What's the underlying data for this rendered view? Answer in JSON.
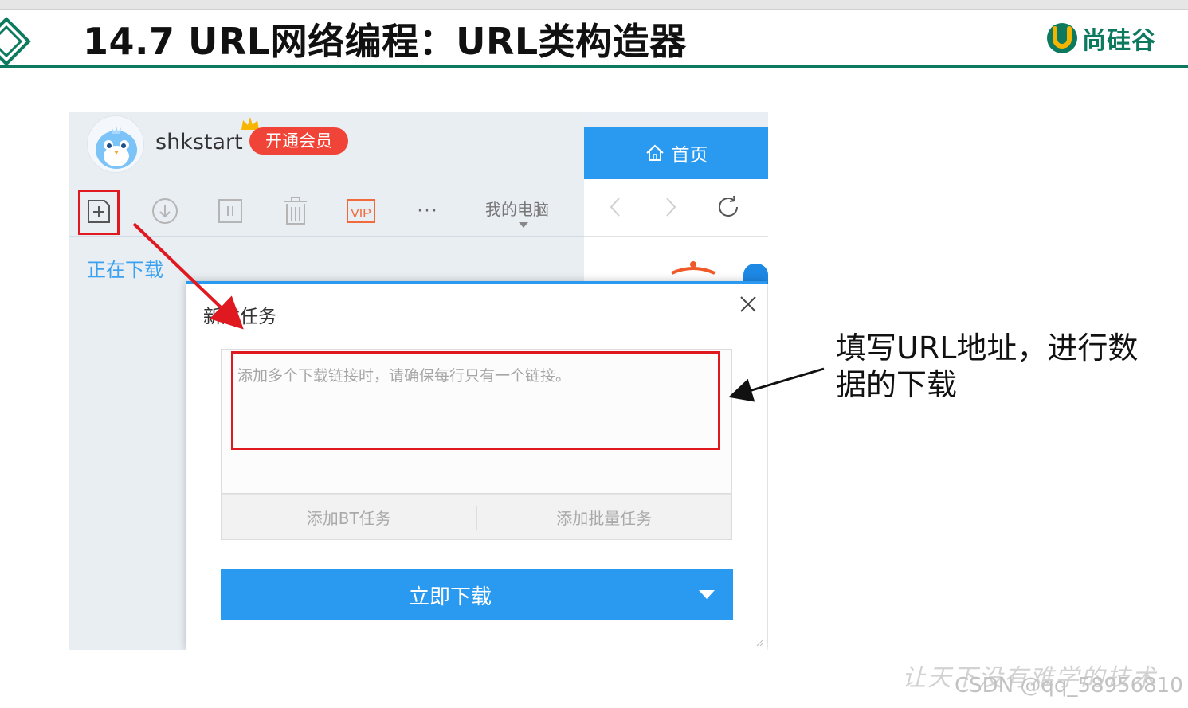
{
  "slide": {
    "title": "14.7 URL网络编程：URL类构造器",
    "brand": "尚硅谷",
    "annotation_line1": "填写URL地址，进行数",
    "annotation_line2": "据的下载",
    "watermark_script": "让天下没有难学的技术",
    "watermark": "CSDN @qq_58956810"
  },
  "colors": {
    "brand_green": "#0d7a5f",
    "accent_blue": "#2a9af0",
    "highlight_red": "#e0181f"
  },
  "app": {
    "username": "shkstart",
    "vip_label": "开通会员",
    "toolbar": {
      "icons": [
        "new-task-icon",
        "download-icon",
        "pause-icon",
        "trash-icon",
        "vip-icon",
        "more-icon"
      ],
      "vip_icon_text": "VIP",
      "more_text": "···",
      "computer_label": "我的电脑"
    },
    "downloading_label": "正在下载",
    "home_tab_label": "首页",
    "dialog": {
      "title": "新建任务",
      "url_placeholder": "添加多个下载链接时，请确保每行只有一个链接。",
      "url_value": "",
      "add_bt_label": "添加BT任务",
      "add_batch_label": "添加批量任务",
      "download_now_label": "立即下载"
    }
  }
}
